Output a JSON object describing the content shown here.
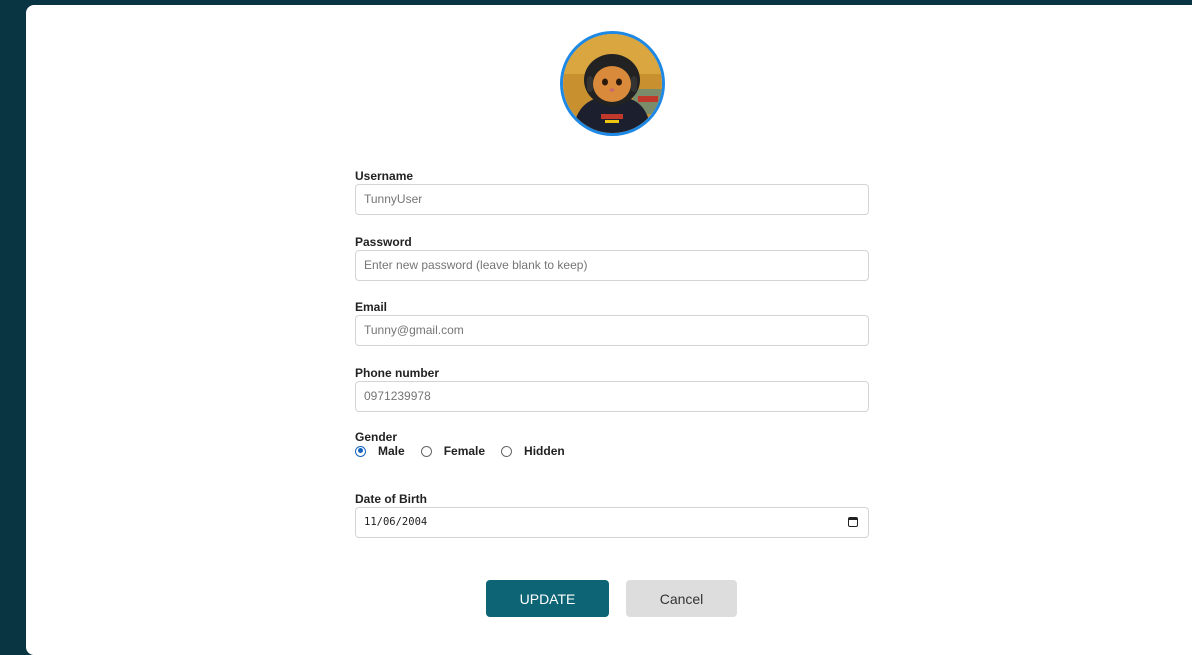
{
  "form": {
    "username": {
      "label": "Username",
      "value": "TunnyUser"
    },
    "password": {
      "label": "Password",
      "placeholder": "Enter new password (leave blank to keep)"
    },
    "email": {
      "label": "Email",
      "value": "Tunny@gmail.com"
    },
    "phone": {
      "label": "Phone number",
      "value": "0971239978"
    },
    "gender": {
      "label": "Gender",
      "options": [
        "Male",
        "Female",
        "Hidden"
      ],
      "selected": "Male"
    },
    "dob": {
      "label": "Date of Birth",
      "value": "11/06/2004"
    }
  },
  "buttons": {
    "update_label": "UPDATE",
    "cancel_label": "Cancel"
  },
  "colors": {
    "background": "#093542",
    "primary": "#0d6475",
    "avatar_border": "#1e88e5"
  },
  "icons": {
    "date_picker": "calendar-icon"
  }
}
